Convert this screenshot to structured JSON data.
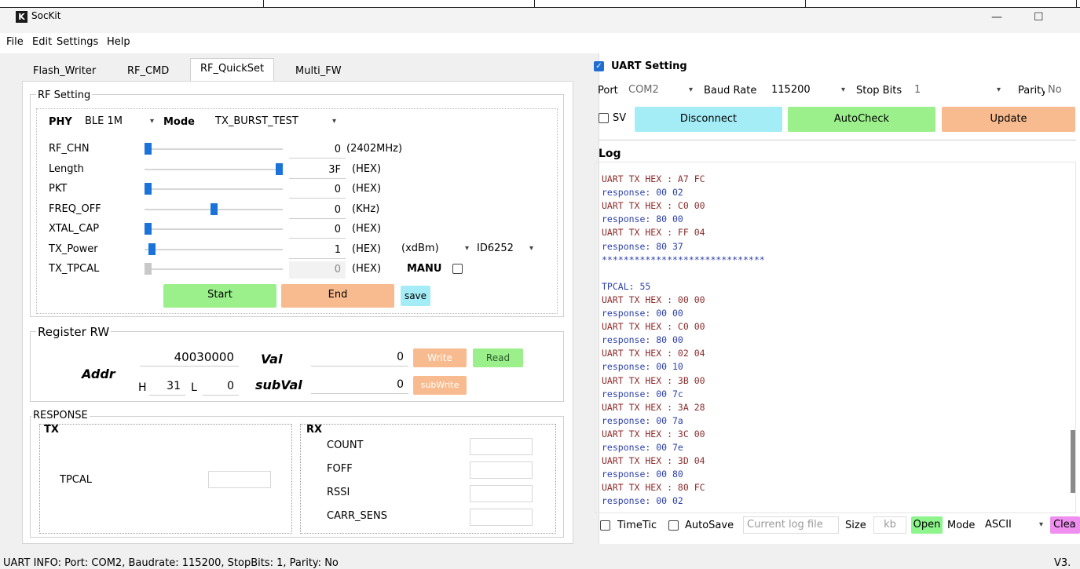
{
  "app": {
    "logo_letter": "K",
    "title": "SocKit",
    "minimize": "—",
    "maximize": "☐"
  },
  "menu": [
    "File",
    "Edit",
    "Settings",
    "Help"
  ],
  "tabs": [
    {
      "label": "Flash_Writer",
      "active": false
    },
    {
      "label": "RF_CMD",
      "active": false
    },
    {
      "label": "RF_QuickSet",
      "active": true
    },
    {
      "label": "Multi_FW",
      "active": false
    }
  ],
  "rf_setting": {
    "title": "RF Setting",
    "phy_label": "PHY",
    "phy_value": "BLE 1M",
    "mode_label": "Mode",
    "mode_value": "TX_BURST_TEST",
    "rows": [
      {
        "label": "RF_CHN",
        "value": "0",
        "unit": "(2402MHz)",
        "level": 0.0,
        "enabled": true
      },
      {
        "label": "Length",
        "value": "3F",
        "unit": "(HEX)",
        "level": 1.0,
        "enabled": true
      },
      {
        "label": "PKT",
        "value": "0",
        "unit": "(HEX)",
        "level": 0.0,
        "enabled": true
      },
      {
        "label": "FREQ_OFF",
        "value": "0",
        "unit": "(KHz)",
        "level": 0.5,
        "enabled": true
      },
      {
        "label": "XTAL_CAP",
        "value": "0",
        "unit": "(HEX)",
        "level": 0.0,
        "enabled": true
      },
      {
        "label": "TX_Power",
        "value": "1",
        "unit": "(HEX)",
        "level": 0.03,
        "enabled": true
      },
      {
        "label": "TX_TPCAL",
        "value": "0",
        "unit": "(HEX)",
        "level": 0.0,
        "enabled": false
      }
    ],
    "power_unit": "(xdBm)",
    "chip": "ID6252",
    "manu_label": "MANU",
    "start": "Start",
    "end": "End",
    "save": "save"
  },
  "register_rw": {
    "title": "Register RW",
    "addr_label": "Addr",
    "addr_value": "40030000",
    "h_label": "H",
    "h_value": "31",
    "l_label": "L",
    "l_value": "0",
    "val_label": "Val",
    "val_value": "0",
    "subval_label": "subVal",
    "subval_value": "0",
    "write": "Write",
    "read": "Read",
    "subwrite": "subWrite"
  },
  "response": {
    "title": "RESPONSE",
    "tx_label": "TX",
    "tpcal_label": "TPCAL",
    "tpcal_value": "",
    "rx_label": "RX",
    "rx_fields": [
      {
        "label": "COUNT",
        "value": ""
      },
      {
        "label": "FOFF",
        "value": ""
      },
      {
        "label": "RSSI",
        "value": ""
      },
      {
        "label": "CARR_SENS",
        "value": ""
      }
    ]
  },
  "uart": {
    "title": "UART Setting",
    "checked": true,
    "port_label": "Port",
    "port_value": "COM2",
    "baud_label": "Baud Rate",
    "baud_value": "115200",
    "stop_label": "Stop Bits",
    "stop_value": "1",
    "parity_label": "Parity",
    "parity_value": "No",
    "sv_label": "SV",
    "disconnect": "Disconnect",
    "autocheck": "AutoCheck",
    "update": "Update"
  },
  "log": {
    "title": "Log",
    "lines": [
      {
        "text": "UART TX HEX : A7 FC",
        "kind": "tx"
      },
      {
        "text": "response: 00 02",
        "kind": "resp"
      },
      {
        "text": "UART TX HEX : C0 00",
        "kind": "tx"
      },
      {
        "text": "response: 80 00",
        "kind": "resp"
      },
      {
        "text": "UART TX HEX : FF 04",
        "kind": "tx"
      },
      {
        "text": "response: 80 37",
        "kind": "resp"
      },
      {
        "text": "******************************",
        "kind": "resp"
      },
      {
        "text": "",
        "kind": "resp"
      },
      {
        "text": "TPCAL: 55",
        "kind": "resp"
      },
      {
        "text": "UART TX HEX : 00 00",
        "kind": "tx"
      },
      {
        "text": "response: 00 00",
        "kind": "resp"
      },
      {
        "text": "UART TX HEX : C0 00",
        "kind": "tx"
      },
      {
        "text": "response: 80 00",
        "kind": "resp"
      },
      {
        "text": "UART TX HEX : 02 04",
        "kind": "tx"
      },
      {
        "text": "response: 00 10",
        "kind": "resp"
      },
      {
        "text": "UART TX HEX : 3B 00",
        "kind": "tx"
      },
      {
        "text": "response: 00 7c",
        "kind": "resp"
      },
      {
        "text": "UART TX HEX : 3A 28",
        "kind": "tx"
      },
      {
        "text": "response: 00 7a",
        "kind": "resp"
      },
      {
        "text": "UART TX HEX : 3C 00",
        "kind": "tx"
      },
      {
        "text": "response: 00 7e",
        "kind": "resp"
      },
      {
        "text": "UART TX HEX : 3D 04",
        "kind": "tx"
      },
      {
        "text": "response: 00 80",
        "kind": "resp"
      },
      {
        "text": "UART TX HEX : 80 FC",
        "kind": "tx"
      },
      {
        "text": "response: 00 02",
        "kind": "resp"
      }
    ],
    "tx_color": "#8b2c2c",
    "resp_color": "#2b3fa8"
  },
  "log_footer": {
    "timetic_label": "TimeTic",
    "autosave_label": "AutoSave",
    "logfile_placeholder": "Current log file",
    "size_label": "Size",
    "size_unit": "kb",
    "open": "Open",
    "mode_label": "Mode",
    "mode_value": "ASCII",
    "clear": "Clea"
  },
  "status": {
    "text": "UART INFO: Port: COM2, Baudrate: 115200, StopBits: 1, Parity: No",
    "version": "V3."
  },
  "colors": {
    "green": "#9bf08c",
    "orange": "#f8bb8f",
    "cyan": "#a4ecf6",
    "accent": "#1f6fd1",
    "open_green": "#8df58c",
    "clear_pink": "#ef8ff0"
  }
}
